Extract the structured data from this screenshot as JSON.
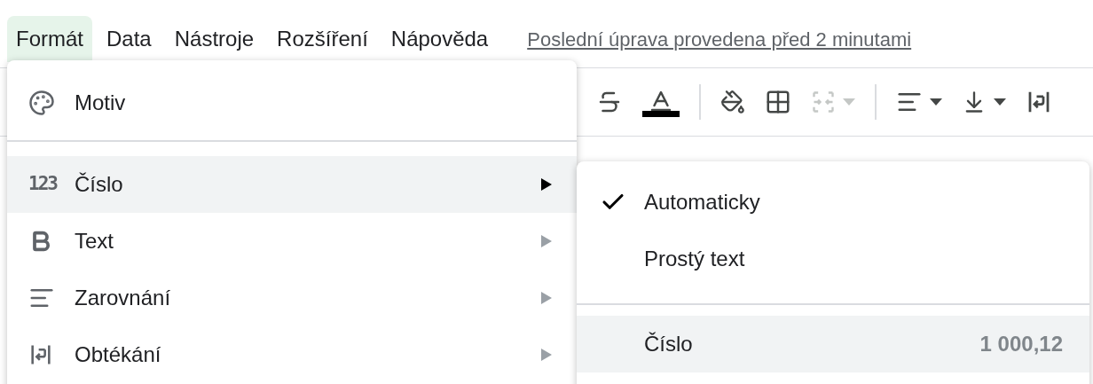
{
  "menubar": {
    "items": [
      {
        "label": "Formát",
        "selected": true
      },
      {
        "label": "Data",
        "selected": false
      },
      {
        "label": "Nástroje",
        "selected": false
      },
      {
        "label": "Rozšíření",
        "selected": false
      },
      {
        "label": "Nápověda",
        "selected": false
      }
    ],
    "last_edit": "Poslední úprava provedena před 2 minutami"
  },
  "toolbar": {
    "items": [
      {
        "kind": "strikethrough",
        "disabled": false
      },
      {
        "kind": "text-color",
        "disabled": false
      },
      {
        "kind": "separator"
      },
      {
        "kind": "fill-color",
        "disabled": false
      },
      {
        "kind": "borders",
        "disabled": false
      },
      {
        "kind": "merge",
        "disabled": true
      },
      {
        "kind": "separator"
      },
      {
        "kind": "align",
        "disabled": false
      },
      {
        "kind": "valign",
        "disabled": false
      },
      {
        "kind": "wrap",
        "disabled": false
      }
    ]
  },
  "format_menu": {
    "items": [
      {
        "kind": "palette",
        "label": "Motiv",
        "selected": false,
        "submenu": false
      },
      {
        "kind": "divider"
      },
      {
        "kind": "number",
        "icon_text": "123",
        "label": "Číslo",
        "selected": true,
        "submenu": true
      },
      {
        "kind": "bold",
        "label": "Text",
        "selected": false,
        "submenu": true
      },
      {
        "kind": "align",
        "label": "Zarovnání",
        "selected": false,
        "submenu": true
      },
      {
        "kind": "wrap",
        "label": "Obtékání",
        "selected": false,
        "submenu": true
      }
    ]
  },
  "number_submenu": {
    "items": [
      {
        "kind": "item",
        "label": "Automaticky",
        "checked": true,
        "selected": false
      },
      {
        "kind": "item",
        "label": "Prostý text",
        "checked": false,
        "selected": false
      },
      {
        "kind": "divider"
      },
      {
        "kind": "item",
        "label": "Číslo",
        "value": "1 000,12",
        "checked": false,
        "selected": true
      }
    ]
  }
}
